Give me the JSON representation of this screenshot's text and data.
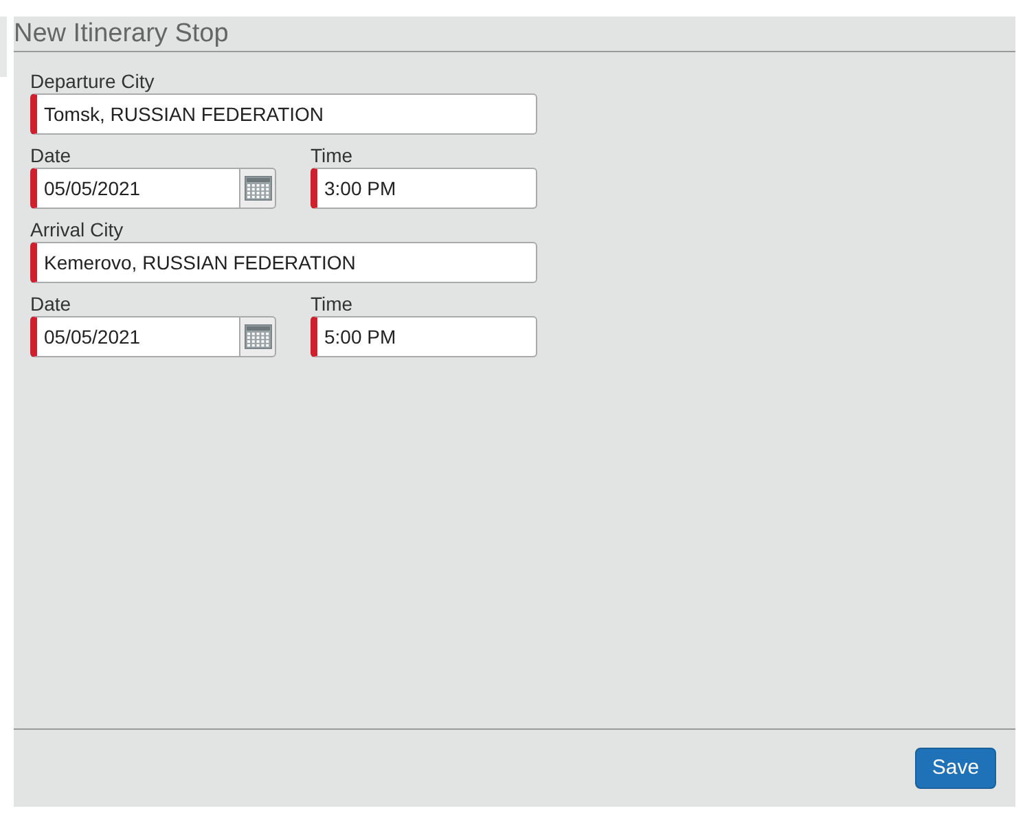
{
  "dialog": {
    "title": "New Itinerary Stop"
  },
  "groups": [
    {
      "city": {
        "label": "Departure City",
        "value": "Tomsk, RUSSIAN FEDERATION",
        "required": true
      },
      "date": {
        "label": "Date",
        "value": "05/05/2021",
        "required": true
      },
      "time": {
        "label": "Time",
        "value": "3:00 PM",
        "required": true
      }
    },
    {
      "city": {
        "label": "Arrival City",
        "value": "Kemerovo, RUSSIAN FEDERATION",
        "required": true
      },
      "date": {
        "label": "Date",
        "value": "05/05/2021",
        "required": true
      },
      "time": {
        "label": "Time",
        "value": "5:00 PM",
        "required": true
      }
    }
  ],
  "buttons": [
    "Save"
  ]
}
